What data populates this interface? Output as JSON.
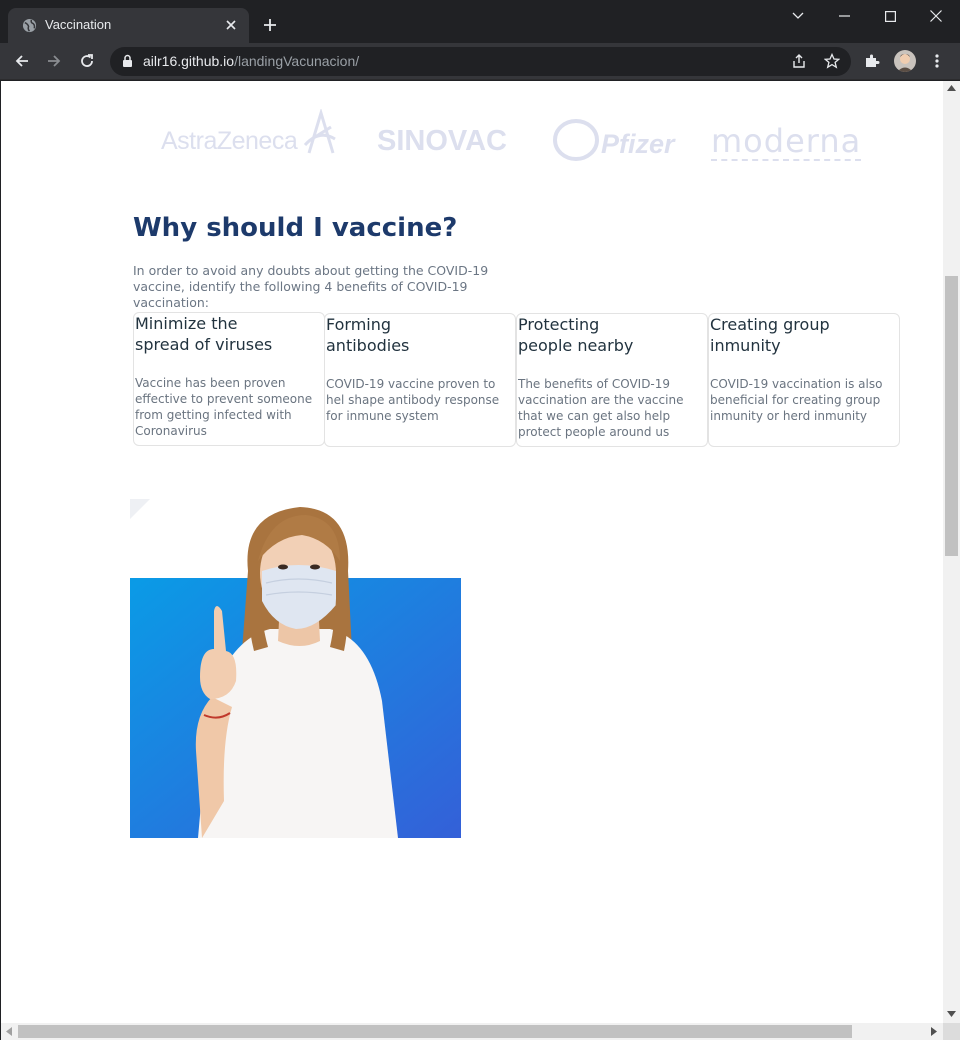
{
  "browser": {
    "tab_title": "Vaccination",
    "url_host": "ailr16.github.io",
    "url_path": "/landingVacunacion/"
  },
  "logos": [
    "AstraZeneca",
    "SINOVAC",
    "Pfizer",
    "moderna"
  ],
  "section": {
    "heading": "Why should I vaccine?",
    "intro": "In order to avoid any doubts about getting the COVID-19 vaccine, identify the following 4 benefits of COVID-19 vaccination:"
  },
  "cards": [
    {
      "title_1": "Minimize the",
      "title_2": "spread of viruses",
      "text": "Vaccine has been proven effective to prevent someone from getting infected with Coronavirus"
    },
    {
      "title_1": "Forming",
      "title_2": "antibodies",
      "text": "COVID-19 vaccine proven to hel shape antibody response for inmune system"
    },
    {
      "title_1": "Protecting",
      "title_2": "people nearby",
      "text": "The benefits of COVID-19 vaccination are the vaccine that we can get also help protect people around us"
    },
    {
      "title_1": "Creating group",
      "title_2": "inmunity",
      "text": "COVID-19 vaccination is also beneficial for creating group inmunity or herd inmunity"
    }
  ],
  "colors": {
    "heading": "#1d3a6b",
    "photo_bg_start": "#0a9be6",
    "photo_bg_end": "#3460d8"
  }
}
